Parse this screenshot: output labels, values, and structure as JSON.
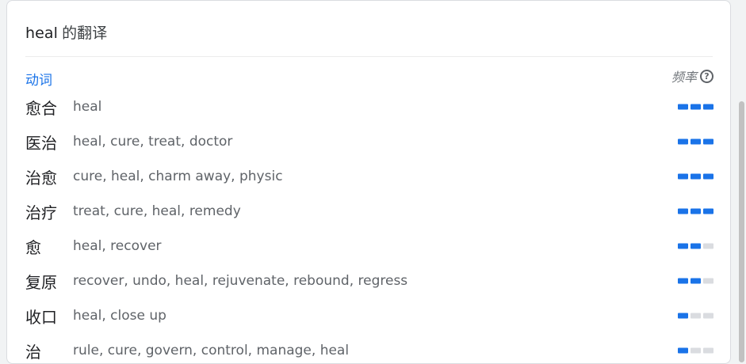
{
  "card": {
    "title_word": "heal",
    "title_suffix": "的翻译",
    "pos": "动词",
    "freq_label": "频率",
    "help_icon": "question-circle-icon"
  },
  "colors": {
    "accent": "#1a73e8",
    "bar_off": "#dadce0"
  },
  "entries": [
    {
      "word": "愈合",
      "translations": "heal",
      "frequency": 3
    },
    {
      "word": "医治",
      "translations": "heal, cure, treat, doctor",
      "frequency": 3
    },
    {
      "word": "治愈",
      "translations": "cure, heal, charm away, physic",
      "frequency": 3
    },
    {
      "word": "治疗",
      "translations": "treat, cure, heal, remedy",
      "frequency": 3
    },
    {
      "word": "愈",
      "translations": "heal, recover",
      "frequency": 2
    },
    {
      "word": "复原",
      "translations": "recover, undo, heal, rejuvenate, rebound, regress",
      "frequency": 2
    },
    {
      "word": "收口",
      "translations": "heal, close up",
      "frequency": 1
    },
    {
      "word": "治",
      "translations": "rule, cure, govern, control, manage, heal",
      "frequency": 1
    }
  ]
}
